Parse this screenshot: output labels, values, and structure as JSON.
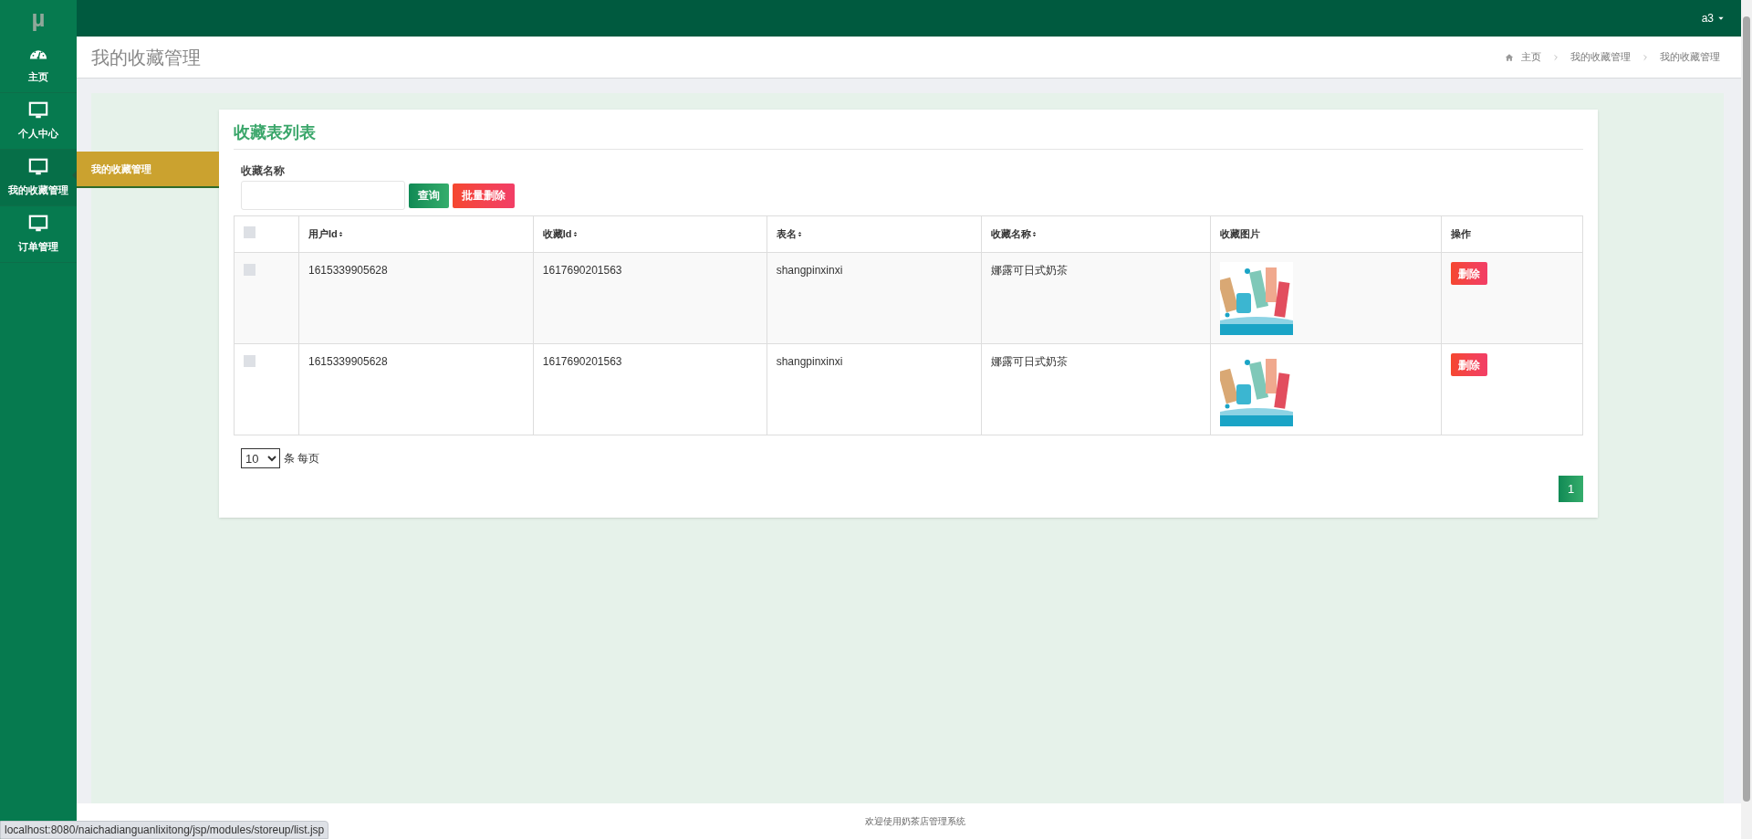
{
  "topbar": {
    "logo": "µ",
    "user": "a3"
  },
  "sidebar": {
    "items": [
      {
        "label": "主页",
        "kind": "dashboard",
        "selected": false
      },
      {
        "label": "个人中心",
        "kind": "monitor",
        "selected": false
      },
      {
        "label": "我的收藏管理",
        "kind": "monitor",
        "selected": true
      },
      {
        "label": "订单管理",
        "kind": "monitor",
        "selected": false
      }
    ]
  },
  "submenu": {
    "items": [
      {
        "label": "我的收藏管理",
        "selected": true
      }
    ]
  },
  "page_header": {
    "title": "我的收藏管理",
    "breadcrumb": [
      "主页",
      "我的收藏管理",
      "我的收藏管理"
    ]
  },
  "card": {
    "title": "收藏表列表",
    "search": {
      "label": "收藏名称",
      "buttons": [
        {
          "label": "查询",
          "kind": "primary"
        },
        {
          "label": "批量删除",
          "kind": "danger"
        }
      ]
    },
    "table": {
      "columns": [
        {
          "label": "用户Id",
          "sortable": true
        },
        {
          "label": "收藏Id",
          "sortable": true
        },
        {
          "label": "表名",
          "sortable": true
        },
        {
          "label": "收藏名称",
          "sortable": true
        },
        {
          "label": "收藏图片",
          "sortable": false
        },
        {
          "label": "操作",
          "sortable": false
        }
      ],
      "header_checked": false,
      "rows": [
        {
          "checked": false,
          "user_id": "1615339905628",
          "storeup_id": "1617690201563",
          "table_name": "shangpinxinxi",
          "name": "娜露可日式奶茶",
          "action": "删除"
        },
        {
          "checked": false,
          "user_id": "1615339905628",
          "storeup_id": "1617690201563",
          "table_name": "shangpinxinxi",
          "name": "娜露可日式奶茶",
          "action": "删除"
        }
      ]
    },
    "page_size": {
      "value": "10",
      "suffix": "条 每页"
    },
    "pagination": [
      {
        "label": "1",
        "selected": true
      }
    ]
  },
  "footer": "欢迎使用奶茶店管理系统",
  "status_url": "localhost:8080/naichadianguanlixitong/jsp/modules/storeup/list.jsp"
}
